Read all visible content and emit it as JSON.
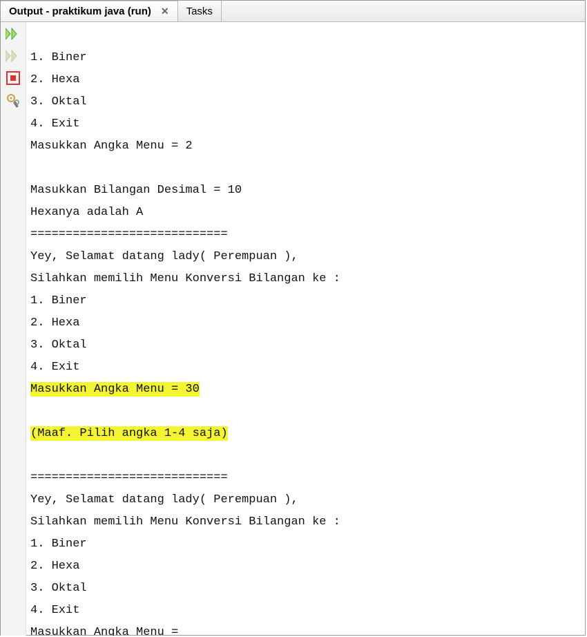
{
  "tabs": {
    "output": "Output - praktikum java (run)",
    "tasks": "Tasks"
  },
  "console": {
    "l01": "1. Biner",
    "l02": "2. Hexa",
    "l03": "3. Oktal",
    "l04": "4. Exit",
    "l05": "Masukkan Angka Menu = 2",
    "l06": "",
    "l07": "Masukkan Bilangan Desimal = 10",
    "l08": "Hexanya adalah A",
    "l09": "============================",
    "l10": "Yey, Selamat datang lady( Perempuan ),",
    "l11": "Silahkan memilih Menu Konversi Bilangan ke :",
    "l12": "1. Biner",
    "l13": "2. Hexa",
    "l14": "3. Oktal",
    "l15": "4. Exit",
    "l16": "Masukkan Angka Menu = 30",
    "l17": "",
    "l18": "(Maaf. Pilih angka 1-4 saja)",
    "l19": "",
    "l20": "============================",
    "l21": "Yey, Selamat datang lady( Perempuan ),",
    "l22": "Silahkan memilih Menu Konversi Bilangan ke :",
    "l23": "1. Biner",
    "l24": "2. Hexa",
    "l25": "3. Oktal",
    "l26": "4. Exit",
    "l27": "Masukkan Angka Menu = "
  }
}
